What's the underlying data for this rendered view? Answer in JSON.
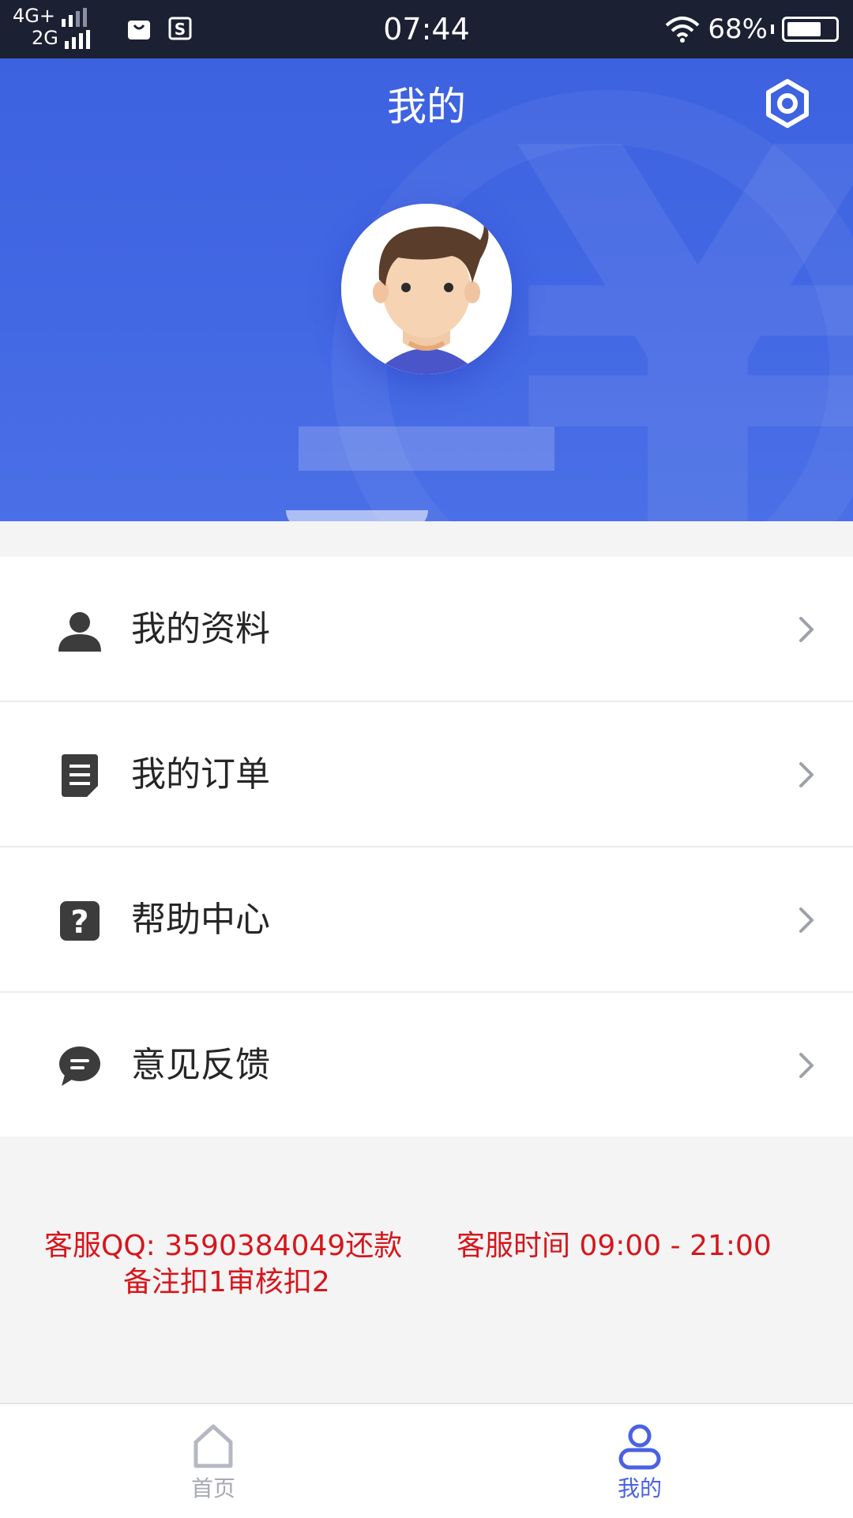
{
  "status_bar": {
    "network_top": "4G+",
    "network_bottom": "2G",
    "time": "07:44",
    "battery": "68%",
    "icons": [
      "shopping-bag-icon",
      "s-app-icon",
      "wifi-icon",
      "battery-icon"
    ]
  },
  "header": {
    "title": "我的",
    "settings_icon": "gear-icon",
    "avatar_icon": "avatar-icon",
    "background_color": "#4368e4"
  },
  "menu": {
    "items": [
      {
        "label": "我的资料",
        "icon": "user-icon"
      },
      {
        "label": "我的订单",
        "icon": "document-icon"
      },
      {
        "label": "帮助中心",
        "icon": "help-icon"
      },
      {
        "label": "意见反馈",
        "icon": "chat-bubble-icon"
      }
    ]
  },
  "notice": {
    "qq": "客服QQ: 3590384049还款",
    "service_hours": "客服时间 09:00 - 21:00",
    "note": "备注扣1审核扣2",
    "color": "#d6161c"
  },
  "tabbar": {
    "tabs": [
      {
        "label": "首页",
        "icon": "home-icon",
        "active": false
      },
      {
        "label": "我的",
        "icon": "profile-icon",
        "active": true
      }
    ],
    "active_color": "#4a62e2",
    "inactive_color": "#a7a9b3"
  }
}
